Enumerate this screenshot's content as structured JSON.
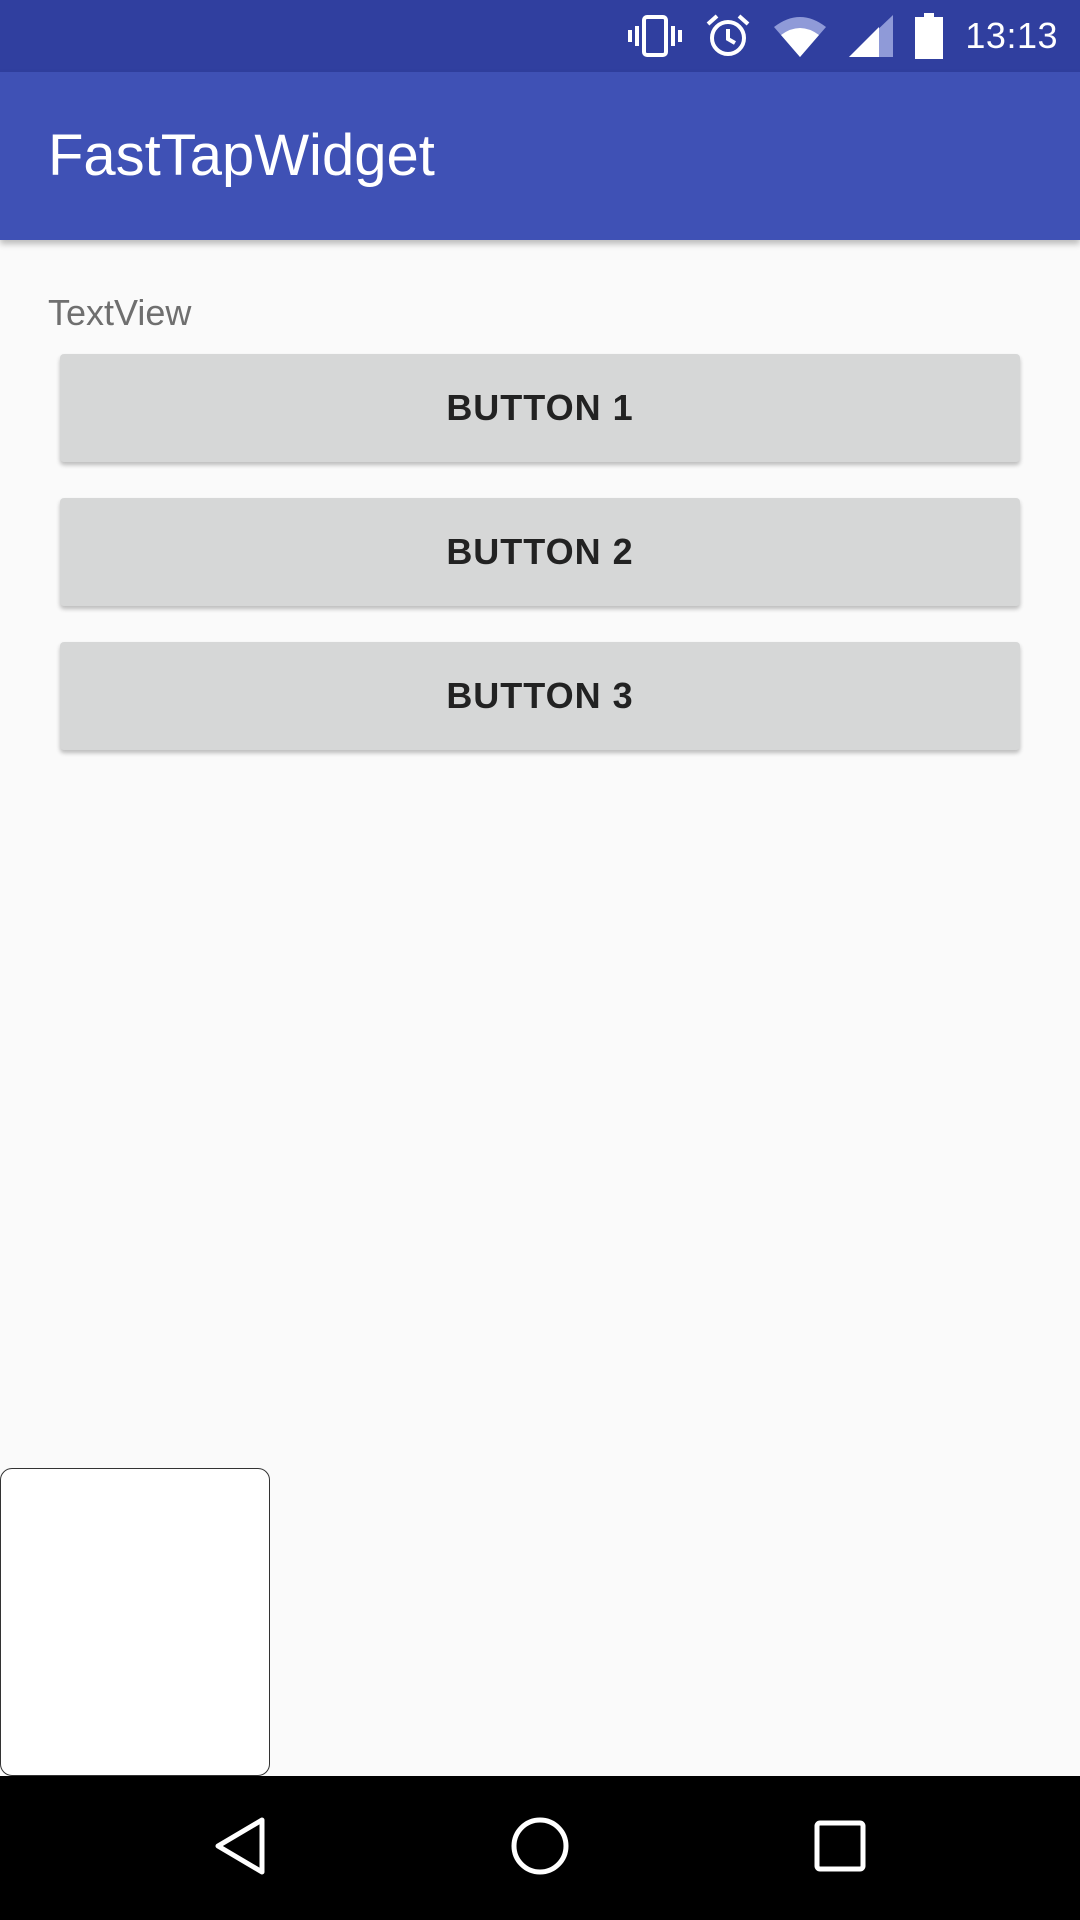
{
  "status_bar": {
    "time": "13:13",
    "icons": [
      "vibrate-icon",
      "alarm-icon",
      "wifi-icon",
      "cell-signal-icon",
      "battery-icon"
    ]
  },
  "app_bar": {
    "title": "FastTapWidget"
  },
  "content": {
    "text_view": "TextView",
    "buttons": [
      {
        "label": "BUTTON 1"
      },
      {
        "label": "BUTTON 2"
      },
      {
        "label": "BUTTON 3"
      }
    ]
  },
  "nav_bar": {
    "icons": [
      "back-icon",
      "home-icon",
      "recents-icon"
    ]
  },
  "colors": {
    "status_bar": "#303f9f",
    "app_bar": "#3f51b5",
    "background": "#fafafa",
    "button": "#d6d7d7",
    "nav_bar": "#000000"
  }
}
